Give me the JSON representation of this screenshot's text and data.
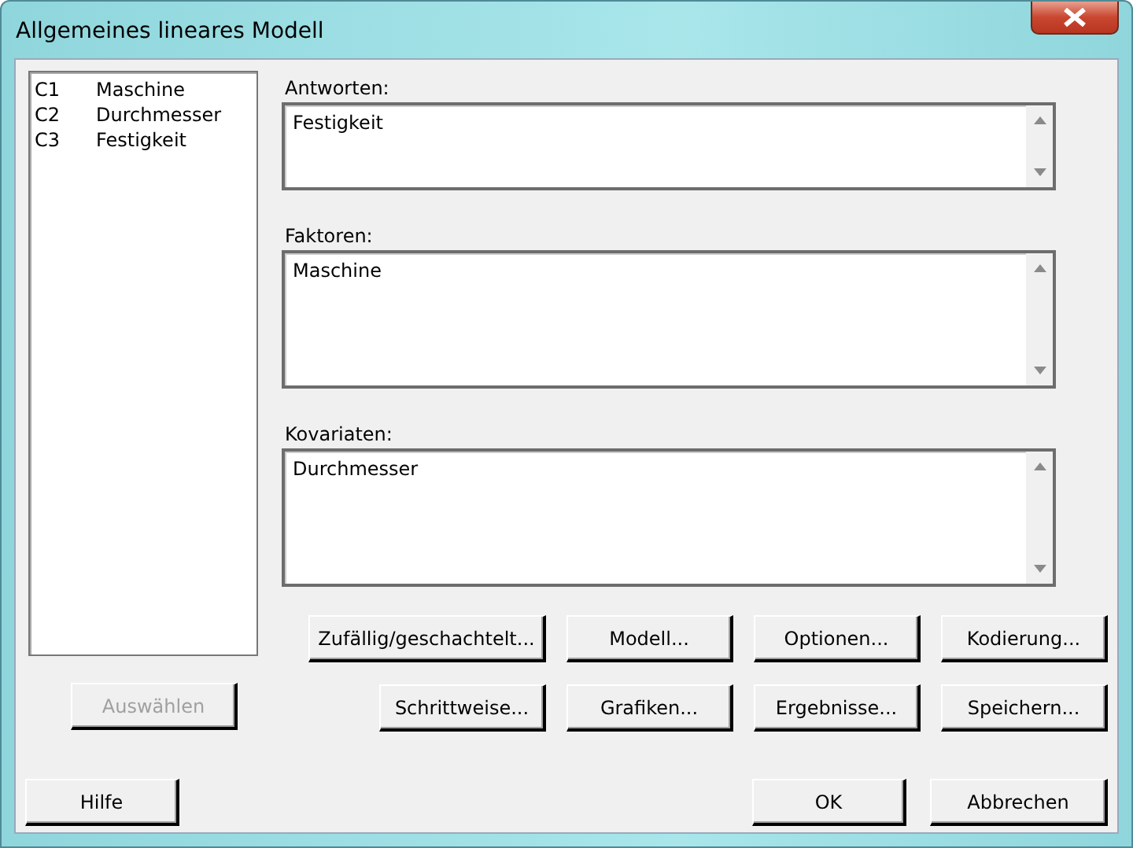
{
  "window": {
    "title": "Allgemeines lineares Modell"
  },
  "columns": [
    {
      "id": "C1",
      "name": "Maschine"
    },
    {
      "id": "C2",
      "name": "Durchmesser"
    },
    {
      "id": "C3",
      "name": "Festigkeit"
    }
  ],
  "fields": [
    {
      "label": "Antworten:",
      "value": "Festigkeit"
    },
    {
      "label": "Faktoren:",
      "value": "Maschine"
    },
    {
      "label": "Kovariaten:",
      "value": "Durchmesser"
    }
  ],
  "select_button": {
    "label": "Auswählen",
    "disabled": true
  },
  "option_buttons": [
    {
      "label": "Zufällig/geschachtelt..."
    },
    {
      "label": "Modell..."
    },
    {
      "label": "Optionen..."
    },
    {
      "label": "Kodierung..."
    },
    {
      "label": "Schrittweise..."
    },
    {
      "label": "Grafiken..."
    },
    {
      "label": "Ergebnisse..."
    },
    {
      "label": "Speichern..."
    }
  ],
  "footer_buttons": [
    {
      "label": "Hilfe"
    },
    {
      "label": "OK"
    },
    {
      "label": "Abbrechen"
    }
  ]
}
